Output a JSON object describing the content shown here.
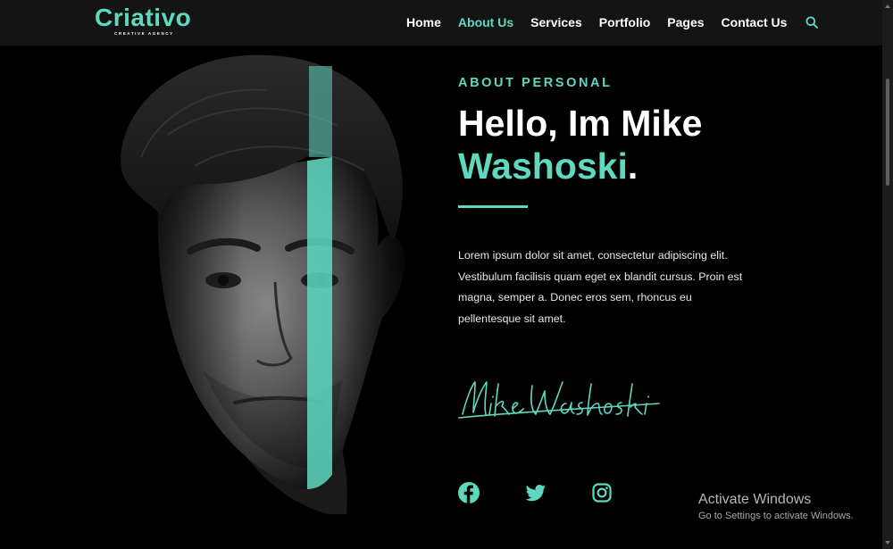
{
  "brand": {
    "name": "Criativo",
    "tagline": "CREATIVE AGENCY",
    "accent_color": "#5fd8bf"
  },
  "nav": {
    "items": [
      {
        "label": "Home",
        "active": false
      },
      {
        "label": "About Us",
        "active": true
      },
      {
        "label": "Services",
        "active": false
      },
      {
        "label": "Portfolio",
        "active": false
      },
      {
        "label": "Pages",
        "active": false
      },
      {
        "label": "Contact Us",
        "active": false
      }
    ],
    "search_icon": "search-icon"
  },
  "hero": {
    "eyebrow": "ABOUT PERSONAL",
    "title_line1": "Hello, Im Mike",
    "title_accent": "Washoski",
    "title_period": ".",
    "bio": "Lorem ipsum dolor sit amet, consectetur adipiscing elit. Vestibulum facilisis quam eget ex blandit cursus. Proin est magna, semper a. Donec eros sem, rhoncus eu pellentesque sit amet.",
    "signature": "Mike Washoski"
  },
  "social": [
    {
      "icon": "facebook-icon"
    },
    {
      "icon": "twitter-icon"
    },
    {
      "icon": "instagram-icon"
    }
  ],
  "watermark": {
    "title": "Activate Windows",
    "subtitle": "Go to Settings to activate Windows."
  }
}
